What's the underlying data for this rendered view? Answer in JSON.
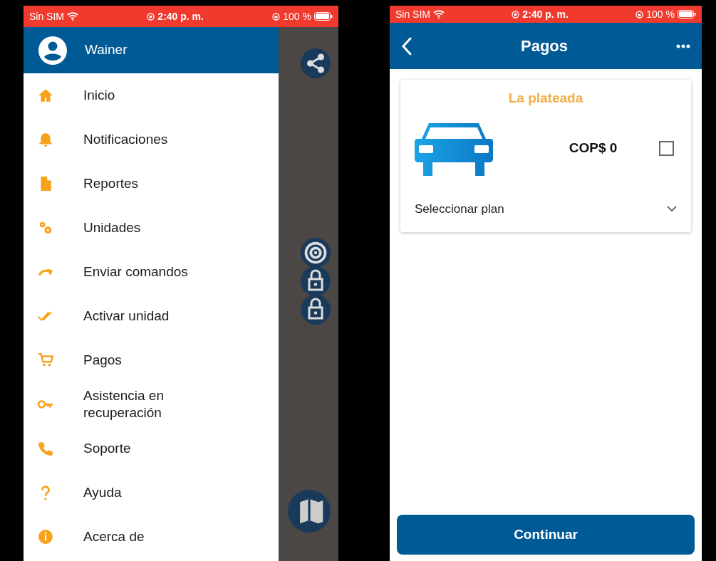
{
  "left_phone": {
    "status_bar": {
      "carrier": "Sin SIM",
      "time": "2:40 p. m.",
      "battery": "100 %"
    },
    "drawer": {
      "user_name": "Wainer",
      "items": [
        {
          "label": "Inicio"
        },
        {
          "label": "Notificaciones"
        },
        {
          "label": "Reportes"
        },
        {
          "label": "Unidades"
        },
        {
          "label": "Enviar comandos"
        },
        {
          "label": "Activar unidad"
        },
        {
          "label": "Pagos"
        },
        {
          "label": "Asistencia en recuperación"
        },
        {
          "label": "Soporte"
        },
        {
          "label": "Ayuda"
        },
        {
          "label": "Acerca de"
        }
      ]
    }
  },
  "right_phone": {
    "status_bar": {
      "carrier": "Sin SIM",
      "time": "2:40 p. m.",
      "battery": "100 %"
    },
    "header": {
      "title": "Pagos"
    },
    "card": {
      "name": "La plateada",
      "price": "COP$ 0",
      "checked": false,
      "plan_select": {
        "placeholder": "Seleccionar plan"
      }
    },
    "continue_button": "Continuar"
  }
}
